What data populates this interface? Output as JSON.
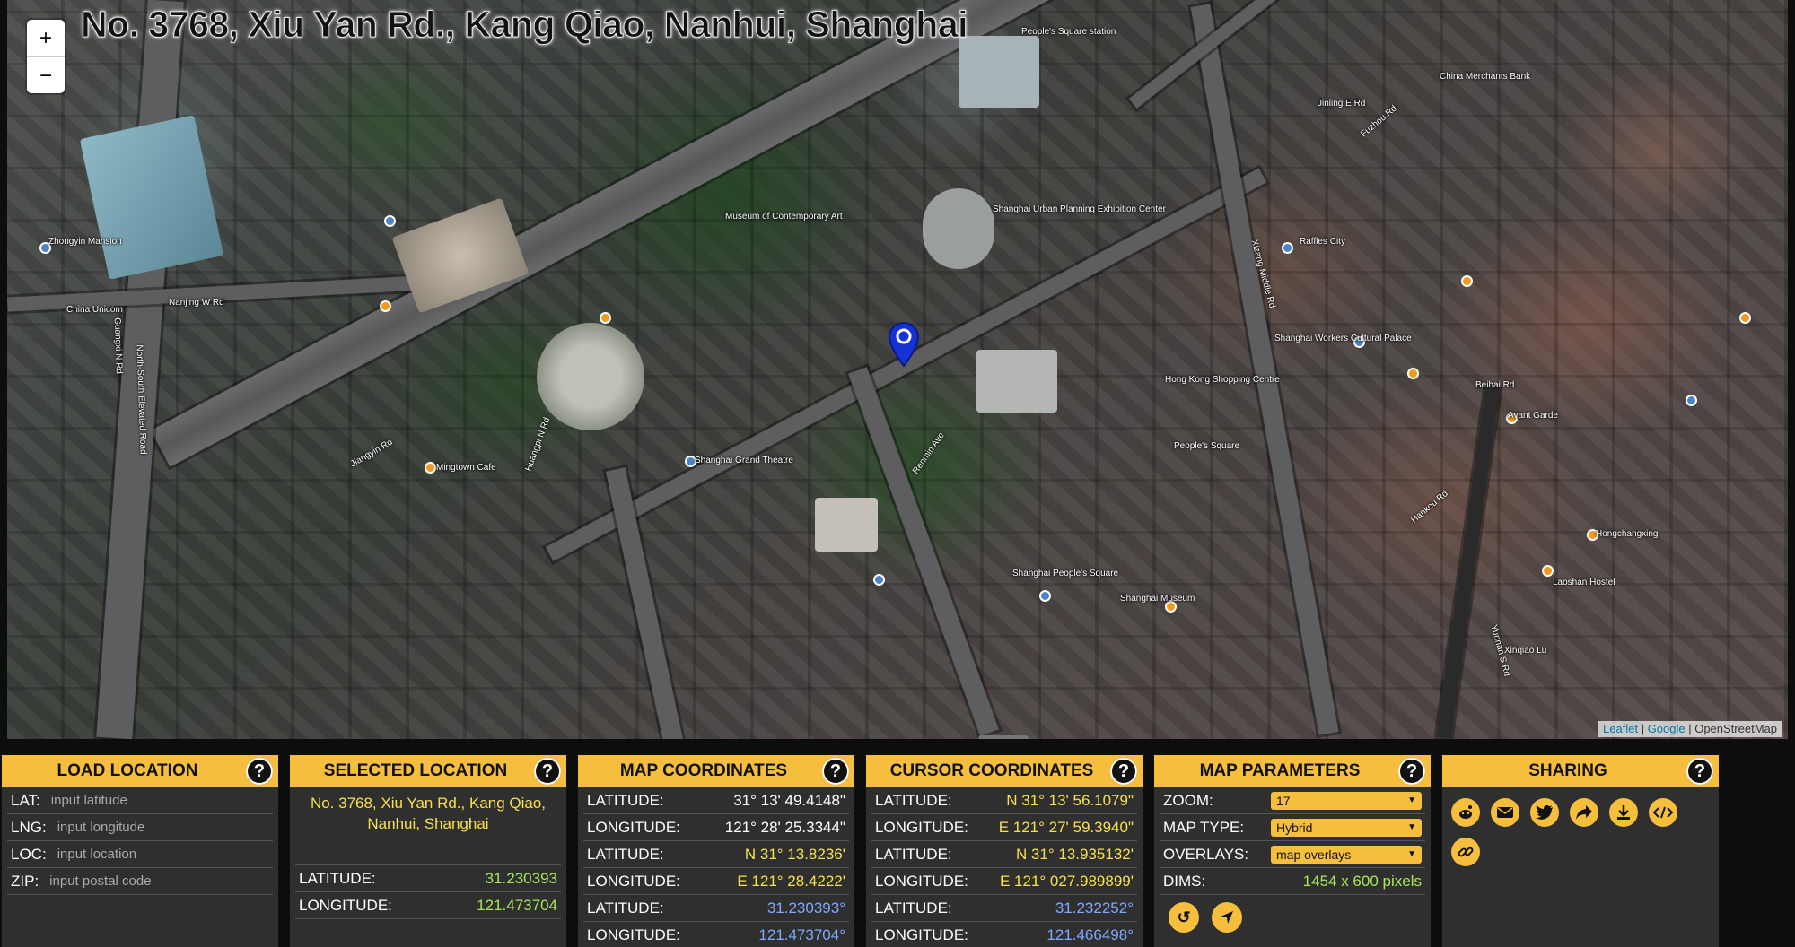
{
  "map": {
    "title": "No. 3768, Xiu Yan Rd., Kang Qiao, Nanhui, Shanghai",
    "zoom_in": "+",
    "zoom_out": "−",
    "attribution": {
      "leaflet": "Leaflet",
      "sep": " | ",
      "google": "Google",
      "osm": "OpenStreetMap"
    },
    "labels": [
      "Nanjing W Rd",
      "Renmin Ave",
      "People's Square",
      "Shanghai Grand Theatre",
      "Shanghai Museum",
      "Huangpi N Rd",
      "Xizang Middle Rd",
      "North-South Elevated Road",
      "Jinling E Rd",
      "Shanghai People's Square",
      "People's Square station",
      "Zhongyin Mansion",
      "China Unicom",
      "Jiangyin Rd",
      "Hong Kong Shopping Centre",
      "Shanghai Urban Planning Exhibition Center",
      "Museum of Contemporary Art",
      "Mingtown Cafe",
      "Hongchangxing",
      "Laoshan Hostel",
      "China Merchants Bank",
      "Fuzhou Rd",
      "Guangxi N Rd",
      "Hankou Rd",
      "Beihai Rd",
      "Raffles City",
      "Shanghai Workers Cultural Palace",
      "Avant Garde",
      "Yunnan S Rd",
      "Xinqiao Lu"
    ]
  },
  "panels": {
    "load": {
      "title": "LOAD LOCATION",
      "help": "?",
      "rows": [
        {
          "label": "LAT:",
          "placeholder": "input latitude"
        },
        {
          "label": "LNG:",
          "placeholder": "input longitude"
        },
        {
          "label": "LOC:",
          "placeholder": "input location"
        },
        {
          "label": "ZIP:",
          "placeholder": "input postal code"
        }
      ]
    },
    "selected": {
      "title": "SELECTED LOCATION",
      "help": "?",
      "address": "No. 3768, Xiu Yan Rd., Kang Qiao, Nanhui, Shanghai",
      "rows": [
        {
          "label": "LATITUDE:",
          "value": "31.230393"
        },
        {
          "label": "LONGITUDE:",
          "value": "121.473704"
        }
      ]
    },
    "mapcoords": {
      "title": "MAP COORDINATES",
      "help": "?",
      "rows": [
        {
          "label": "LATITUDE:",
          "value": "31° 13' 49.4148\""
        },
        {
          "label": "LONGITUDE:",
          "value": "121° 28' 25.3344\""
        },
        {
          "label": "LATITUDE:",
          "value": "N 31° 13.8236'"
        },
        {
          "label": "LONGITUDE:",
          "value": "E 121° 28.4222'"
        },
        {
          "label": "LATITUDE:",
          "value": "31.230393°"
        },
        {
          "label": "LONGITUDE:",
          "value": "121.473704°"
        }
      ]
    },
    "cursor": {
      "title": "CURSOR COORDINATES",
      "help": "?",
      "rows": [
        {
          "label": "LATITUDE:",
          "value": "N 31° 13' 56.1079\""
        },
        {
          "label": "LONGITUDE:",
          "value": "E 121° 27' 59.3940\""
        },
        {
          "label": "LATITUDE:",
          "value": "N 31° 13.935132'"
        },
        {
          "label": "LONGITUDE:",
          "value": "E 121° 027.989899'"
        },
        {
          "label": "LATITUDE:",
          "value": "31.232252°"
        },
        {
          "label": "LONGITUDE:",
          "value": "121.466498°"
        }
      ]
    },
    "params": {
      "title": "MAP PARAMETERS",
      "help": "?",
      "zoom_label": "ZOOM:",
      "zoom_value": "17",
      "type_label": "MAP TYPE:",
      "type_value": "Hybrid",
      "overlays_label": "OVERLAYS:",
      "overlays_value": "map overlays",
      "dims_label": "DIMS:",
      "dims_value": "1454 x 600 pixels"
    },
    "sharing": {
      "title": "SHARING",
      "help": "?"
    }
  },
  "colors": {
    "accent": "#f6be3d",
    "panel_bg": "#2f2f2f",
    "value_yellow": "#f6e14a",
    "value_green": "#a5e65a",
    "value_blue": "#7fa8ff"
  },
  "icons": [
    "reddit-icon",
    "email-icon",
    "twitter-icon",
    "share-icon",
    "download-icon",
    "embed-code-icon",
    "link-icon",
    "reset-icon",
    "locate-icon"
  ]
}
